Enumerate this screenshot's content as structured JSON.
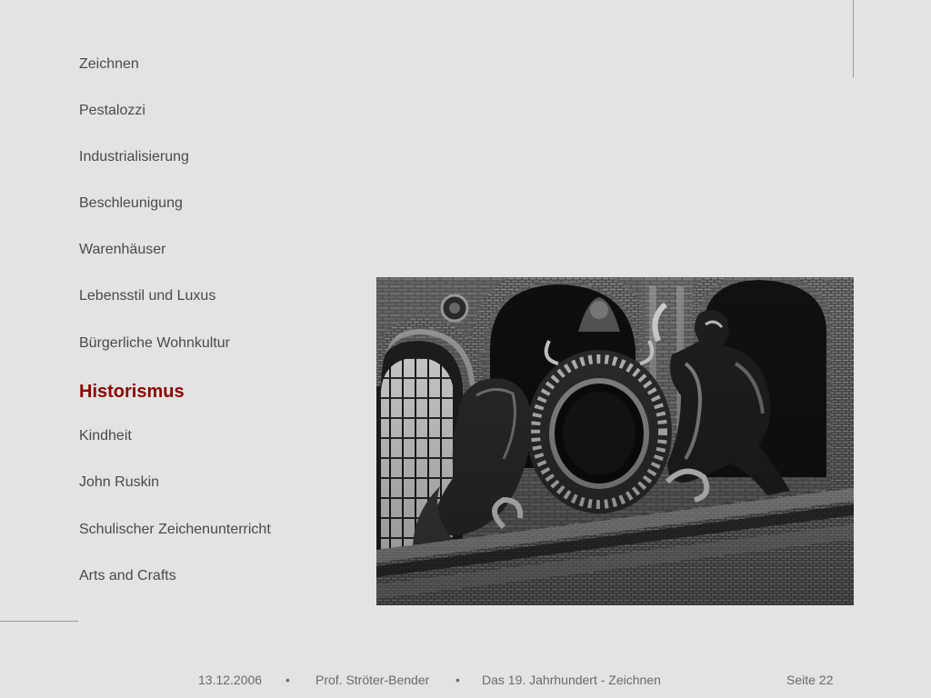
{
  "nav": {
    "items": [
      {
        "label": "Zeichnen"
      },
      {
        "label": "Pestalozzi"
      },
      {
        "label": "Industrialisierung"
      },
      {
        "label": "Beschleunigung"
      },
      {
        "label": "Warenhäuser"
      },
      {
        "label": "Lebensstil und Luxus"
      },
      {
        "label": "Bürgerliche Wohnkultur"
      },
      {
        "label": "Historismus"
      },
      {
        "label": "Kindheit"
      },
      {
        "label": "John Ruskin"
      },
      {
        "label": "Schulischer Zeichenunterricht"
      },
      {
        "label": "Arts and Crafts"
      }
    ],
    "active_label": "Historismus",
    "active_color": "#8b0000"
  },
  "footer": {
    "date": "13.12.2006",
    "separator": "•",
    "author": "Prof. Ströter-Bender",
    "title": "Das 19. Jahrhundert - Zeichnen",
    "page": "Seite 22"
  }
}
